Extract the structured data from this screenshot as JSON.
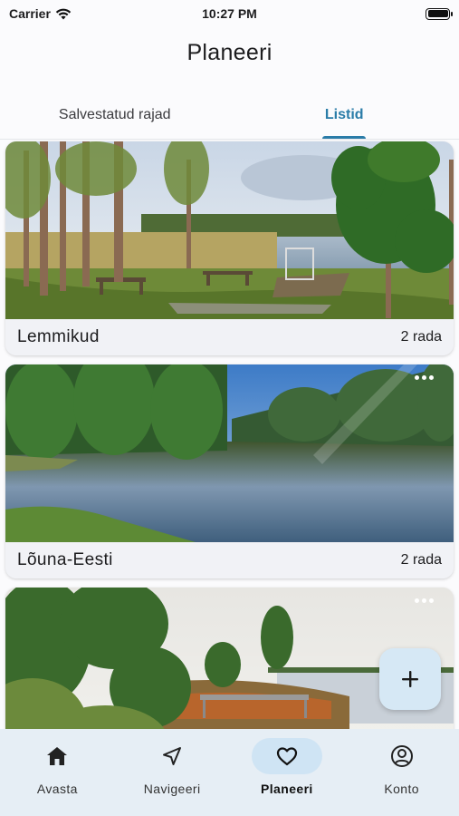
{
  "status_bar": {
    "carrier": "Carrier",
    "time": "10:27 PM"
  },
  "header": {
    "title": "Planeeri"
  },
  "tabs": [
    {
      "label": "Salvestatud rajad",
      "active": false
    },
    {
      "label": "Listid",
      "active": true
    }
  ],
  "lists": [
    {
      "name": "Lemmikud",
      "count": "2 rada"
    },
    {
      "name": "Lõuna-Eesti",
      "count": "2 rada"
    },
    {
      "name": "",
      "count": ""
    }
  ],
  "fab": {
    "icon": "plus-icon"
  },
  "bottom_nav": [
    {
      "label": "Avasta",
      "icon": "home-icon"
    },
    {
      "label": "Navigeeri",
      "icon": "navigate-arrow-icon"
    },
    {
      "label": "Planeeri",
      "icon": "heart-icon",
      "active": true
    },
    {
      "label": "Konto",
      "icon": "account-circle-icon"
    }
  ],
  "colors": {
    "accent": "#2a7ca8",
    "nav_background": "#e6eef5",
    "nav_active_pill": "#cfe4f4",
    "fab_background": "#d6e8f5"
  }
}
